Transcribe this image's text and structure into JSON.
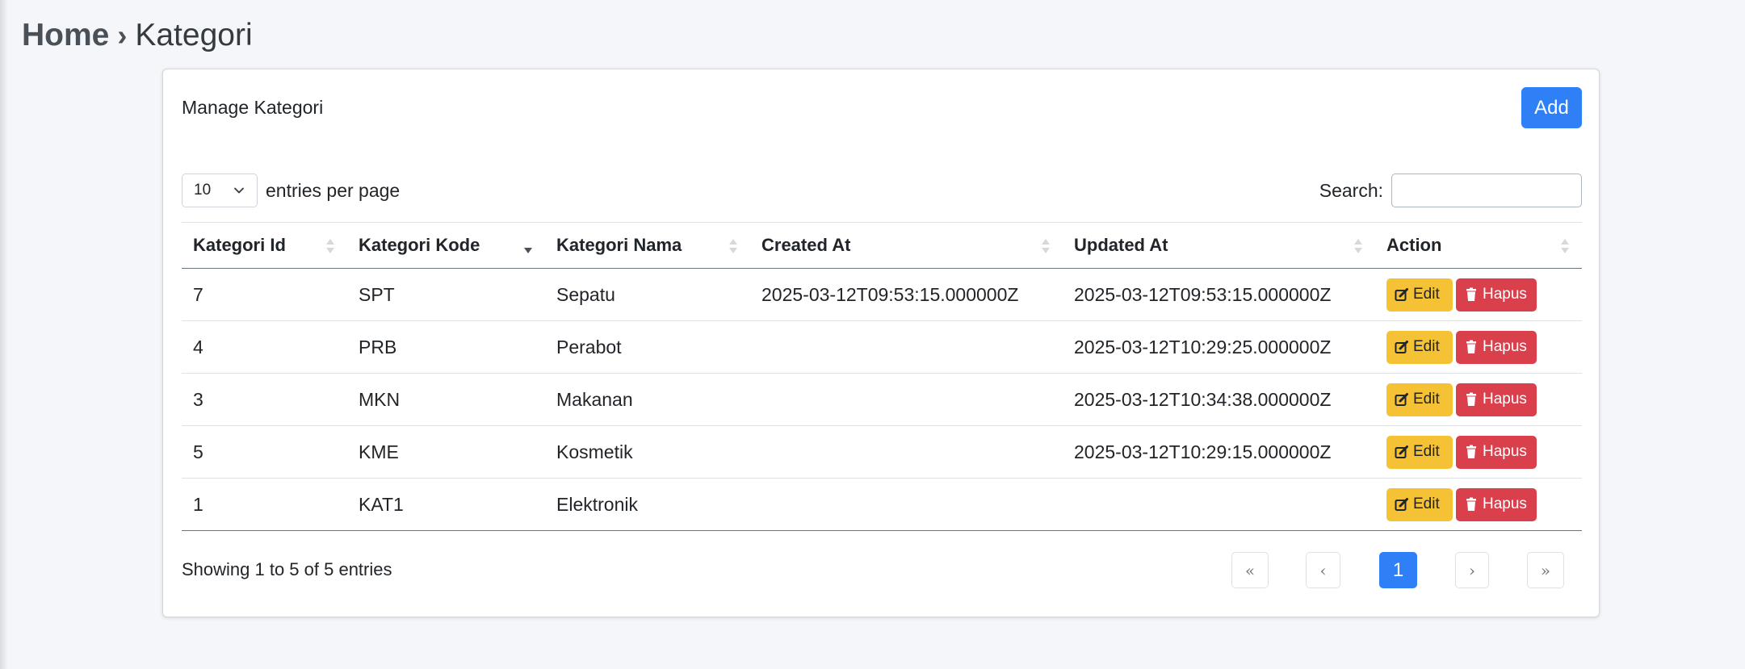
{
  "breadcrumb": {
    "home": "Home",
    "separator": "›",
    "current": "Kategori"
  },
  "card": {
    "title": "Manage Kategori",
    "add_label": "Add"
  },
  "length_menu": {
    "selected": "10",
    "label": "entries per page"
  },
  "search": {
    "label": "Search:",
    "value": ""
  },
  "table": {
    "columns": [
      "Kategori Id",
      "Kategori Kode",
      "Kategori Nama",
      "Created At",
      "Updated At",
      "Action"
    ],
    "sorted_column": "Kategori Kode",
    "sort_direction": "desc",
    "rows": [
      {
        "id": "7",
        "kode": "SPT",
        "nama": "Sepatu",
        "created": "2025-03-12T09:53:15.000000Z",
        "updated": "2025-03-12T09:53:15.000000Z"
      },
      {
        "id": "4",
        "kode": "PRB",
        "nama": "Perabot",
        "created": "",
        "updated": "2025-03-12T10:29:25.000000Z"
      },
      {
        "id": "3",
        "kode": "MKN",
        "nama": "Makanan",
        "created": "",
        "updated": "2025-03-12T10:34:38.000000Z"
      },
      {
        "id": "5",
        "kode": "KME",
        "nama": "Kosmetik",
        "created": "",
        "updated": "2025-03-12T10:29:15.000000Z"
      },
      {
        "id": "1",
        "kode": "KAT1",
        "nama": "Elektronik",
        "created": "",
        "updated": ""
      }
    ],
    "edit_label": "Edit",
    "delete_label": "Hapus"
  },
  "footer": {
    "info": "Showing 1 to 5 of 5 entries",
    "pager": {
      "first": "«",
      "prev": "‹",
      "current": "1",
      "next": "›",
      "last": "»"
    }
  },
  "colors": {
    "primary": "#2f7ff7",
    "warning": "#f5c236",
    "danger": "#d9404b",
    "background": "#f4f6f9"
  },
  "icons": {
    "edit": "pencil-square-icon",
    "delete": "trash-icon",
    "select": "chevron-down-icon"
  }
}
